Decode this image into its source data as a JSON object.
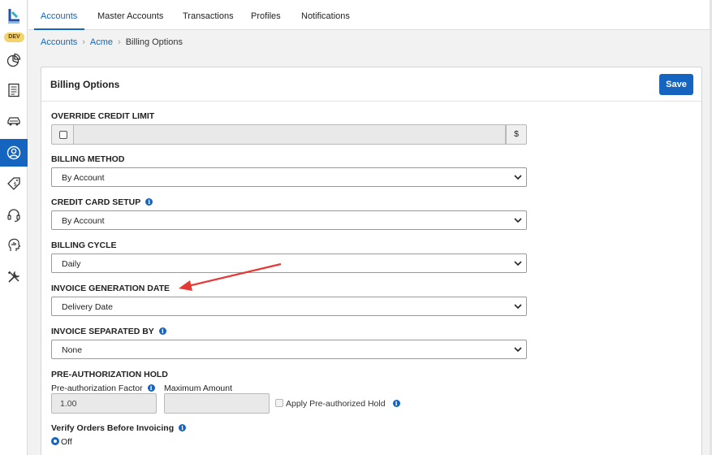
{
  "app": {
    "env_badge": "DEV"
  },
  "rail": {
    "items": [
      {
        "icon": "pie-chart-icon",
        "active": false
      },
      {
        "icon": "receipt-icon",
        "active": false
      },
      {
        "icon": "car-icon",
        "active": false
      },
      {
        "icon": "user-circle-icon",
        "active": true
      },
      {
        "icon": "price-tag-icon",
        "active": false
      },
      {
        "icon": "headset-icon",
        "active": false
      },
      {
        "icon": "head-analytics-icon",
        "active": false
      },
      {
        "icon": "tools-icon",
        "active": false
      }
    ]
  },
  "topnav": {
    "tabs": [
      {
        "label": "Accounts",
        "active": true
      },
      {
        "label": "Master Accounts",
        "active": false
      },
      {
        "label": "Transactions",
        "active": false
      },
      {
        "label": "Profiles",
        "active": false
      },
      {
        "label": "Notifications",
        "active": false
      }
    ]
  },
  "breadcrumb": {
    "items": [
      "Accounts",
      "Acme"
    ],
    "current": "Billing Options"
  },
  "card": {
    "title": "Billing Options",
    "save_label": "Save",
    "override_credit_limit": {
      "label": "OVERRIDE CREDIT LIMIT",
      "value": "",
      "addon": "$",
      "checked": false
    },
    "billing_method": {
      "label": "BILLING METHOD",
      "value": "By Account"
    },
    "credit_card_setup": {
      "label": "CREDIT CARD SETUP",
      "value": "By Account",
      "info_icon": "info-icon"
    },
    "billing_cycle": {
      "label": "BILLING CYCLE",
      "value": "Daily"
    },
    "invoice_generation_date": {
      "label": "INVOICE GENERATION DATE",
      "value": "Delivery Date"
    },
    "invoice_separated_by": {
      "label": "INVOICE SEPARATED BY",
      "value": "None",
      "info_icon": "info-icon"
    },
    "pre_authorization_hold": {
      "label": "PRE-AUTHORIZATION HOLD",
      "factor_label": "Pre-authorization Factor",
      "factor_value": "1.00",
      "max_amount_label": "Maximum Amount",
      "max_amount_value": "",
      "apply_label": "Apply Pre-authorized Hold",
      "apply_checked": false
    },
    "verify_orders": {
      "label": "Verify Orders Before Invoicing",
      "option": "Off",
      "selected": true
    }
  },
  "colors": {
    "accent": "#1565c0",
    "annotation_arrow": "#e53935",
    "badge": "#f5d36b"
  }
}
